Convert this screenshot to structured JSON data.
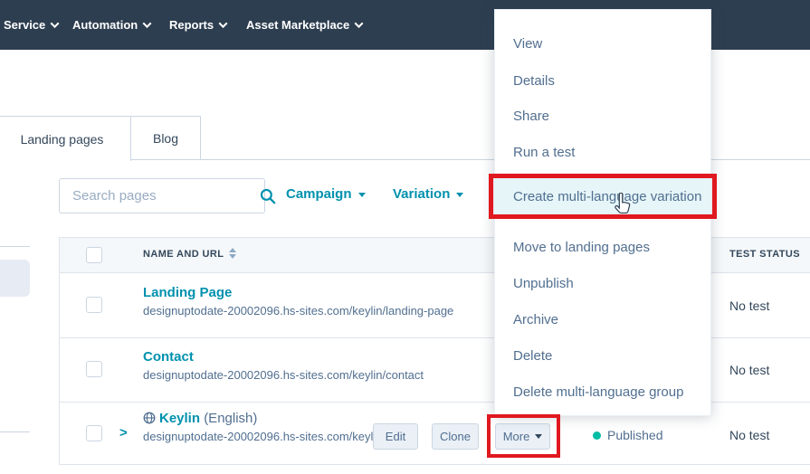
{
  "colors": {
    "nav_bg": "#2d3e50",
    "link_teal": "#0091ae",
    "text_slate": "#33475b",
    "text_muted": "#516f90",
    "border": "#cbd6e2",
    "row_border": "#dfe3eb",
    "header_bg": "#f5f8fa",
    "button_bg": "#eaf0f6",
    "menu_highlight_bg": "#e5f5f8",
    "published_dot": "#00bda5",
    "annotation_red": "#e0181f"
  },
  "nav": {
    "items": [
      "Service",
      "Automation",
      "Reports",
      "Asset Marketplace"
    ]
  },
  "tabs": {
    "items": [
      "Landing pages",
      "Blog"
    ],
    "active": "Landing pages"
  },
  "toolbar": {
    "search_placeholder": "Search pages",
    "filters": [
      "Campaign",
      "Variation"
    ]
  },
  "table": {
    "columns": [
      "NAME AND URL",
      "TEST STATUS"
    ],
    "rows": [
      {
        "name": "Landing Page",
        "url": "designuptodate-20002096.hs-sites.com/keylin/landing-page",
        "test_status": "No test"
      },
      {
        "name": "Contact",
        "url": "designuptodate-20002096.hs-sites.com/keylin/contact",
        "test_status": "No test"
      },
      {
        "name": "Keylin",
        "language": "(English)",
        "url": "designuptodate-20002096.hs-sites.com/keyl",
        "actions": [
          "Edit",
          "Clone",
          "More"
        ],
        "publish_status": "Published",
        "test_status": "No test"
      }
    ]
  },
  "menu": {
    "items": [
      "View",
      "Details",
      "Share",
      "Run a test",
      "Create multi-language variation",
      "Move to landing pages",
      "Unpublish",
      "Archive",
      "Delete",
      "Delete multi-language group"
    ],
    "highlighted_item": "Create multi-language variation"
  }
}
